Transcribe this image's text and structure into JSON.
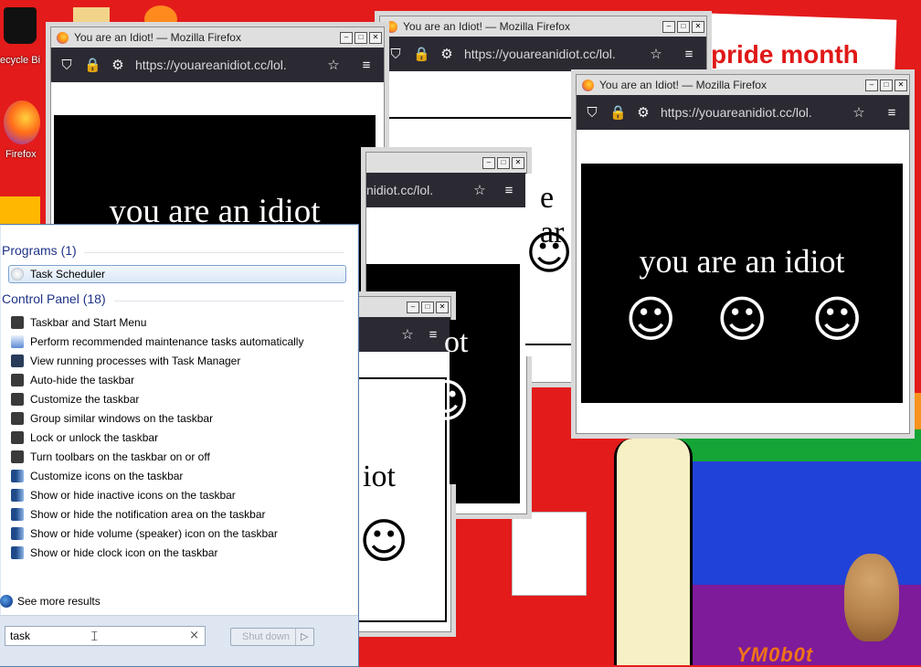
{
  "desktop": {
    "icons": [
      {
        "label": "ecycle Bi",
        "icon": "recycle-bin-icon"
      },
      {
        "label": "Firefox",
        "icon": "firefox-icon"
      }
    ],
    "wallpaper_text": "pride month",
    "watermark": "YM0b0t",
    "colors": {
      "red": "#e31b1b",
      "orange": "#f7931e",
      "yellow": "#ffe81a",
      "green": "#15a536",
      "blue": "#2142d8",
      "purple": "#7d1b9a"
    }
  },
  "windows": [
    {
      "title": "You are an Idiot! — Mozilla Firefox",
      "url": "https://youareanidiot.cc/lol.",
      "text": "you are an idiot",
      "smiley": "☺"
    },
    {
      "title": "You are an Idiot! — Mozilla Firefox",
      "url": "https://youareanidiot.cc/lol.",
      "text": "you are an idiot",
      "smiley": "☺"
    },
    {
      "title": "You are an Idiot! — Mozilla Firefox",
      "url": "https://youareanidiot.cc/lol.",
      "text": "you are an idiot",
      "smiley": "☺"
    },
    {
      "url_fragment": "nidiot.cc/lol.",
      "text_fragment": "e ar",
      "smiley": "☺"
    },
    {
      "text_fragment": "iot",
      "smiley": "☺"
    }
  ],
  "start_menu": {
    "programs_header": "Programs (1)",
    "programs": [
      {
        "label": "Task Scheduler",
        "icon": "clock-icon"
      }
    ],
    "control_panel_header": "Control Panel (18)",
    "control_panel": [
      {
        "label": "Taskbar and Start Menu",
        "icon": "taskbar-icon"
      },
      {
        "label": "Perform recommended maintenance tasks automatically",
        "icon": "action-center-icon"
      },
      {
        "label": "View running processes with Task Manager",
        "icon": "monitor-icon"
      },
      {
        "label": "Auto-hide the taskbar",
        "icon": "taskbar-icon"
      },
      {
        "label": "Customize the taskbar",
        "icon": "taskbar-icon"
      },
      {
        "label": "Group similar windows on the taskbar",
        "icon": "taskbar-icon"
      },
      {
        "label": "Lock or unlock the taskbar",
        "icon": "taskbar-icon"
      },
      {
        "label": "Turn toolbars on the taskbar on or off",
        "icon": "taskbar-icon"
      },
      {
        "label": "Customize icons on the taskbar",
        "icon": "notification-icon"
      },
      {
        "label": "Show or hide inactive icons on the taskbar",
        "icon": "notification-icon"
      },
      {
        "label": "Show or hide the notification area on the taskbar",
        "icon": "notification-icon"
      },
      {
        "label": "Show or hide volume (speaker) icon on the taskbar",
        "icon": "notification-icon"
      },
      {
        "label": "Show or hide clock icon on the taskbar",
        "icon": "notification-icon"
      }
    ],
    "see_more": "See more results",
    "search_value": "task",
    "search_clear": "×",
    "shutdown_label": "Shut down",
    "shutdown_arrow": "▷"
  }
}
